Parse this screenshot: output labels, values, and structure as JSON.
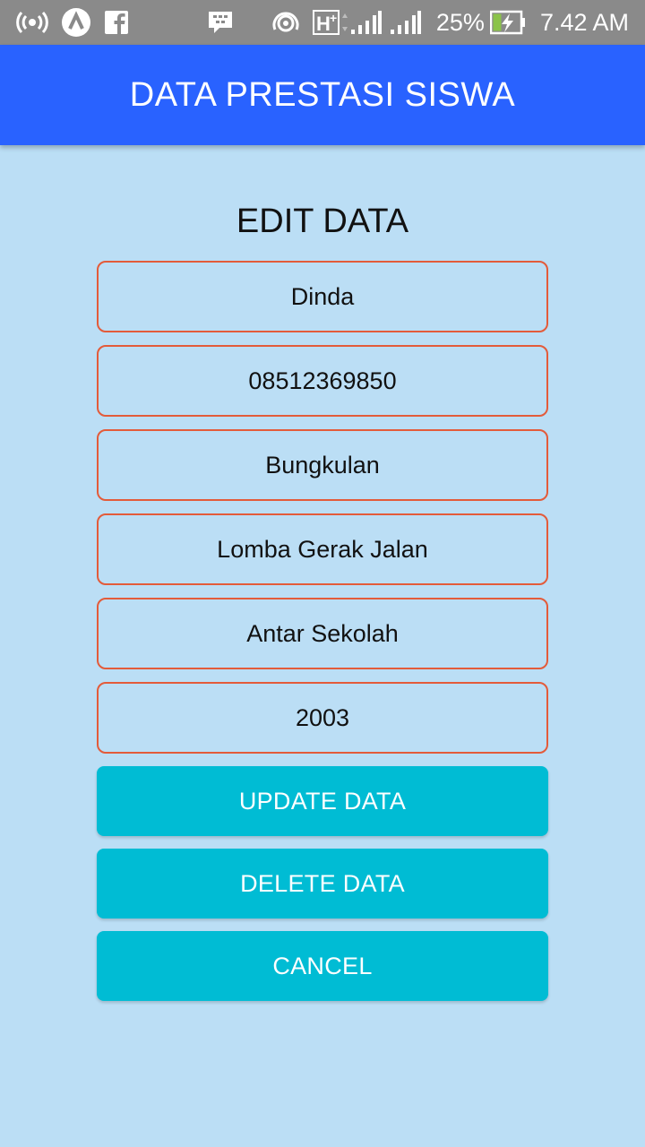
{
  "status_bar": {
    "battery": "25%",
    "time": "7.42 AM",
    "icons": [
      "hotspot-icon",
      "app-a-icon",
      "facebook-icon",
      "bbm-icon",
      "wifi-icon",
      "hplus-icon",
      "signal-icon",
      "signal-icon-2",
      "battery-charging-icon"
    ]
  },
  "app_bar": {
    "title": "DATA PRESTASI SISWA"
  },
  "form": {
    "title": "EDIT DATA",
    "fields": [
      {
        "value": "Dinda"
      },
      {
        "value": "08512369850"
      },
      {
        "value": "Bungkulan"
      },
      {
        "value": "Lomba Gerak Jalan"
      },
      {
        "value": "Antar Sekolah"
      },
      {
        "value": "2003"
      }
    ],
    "buttons": {
      "update": "UPDATE DATA",
      "delete": "DELETE DATA",
      "cancel": "CANCEL"
    }
  },
  "colors": {
    "app_bar": "#2962ff",
    "background": "#bbdef5",
    "field_border": "#e35b3a",
    "button": "#00bcd4"
  }
}
